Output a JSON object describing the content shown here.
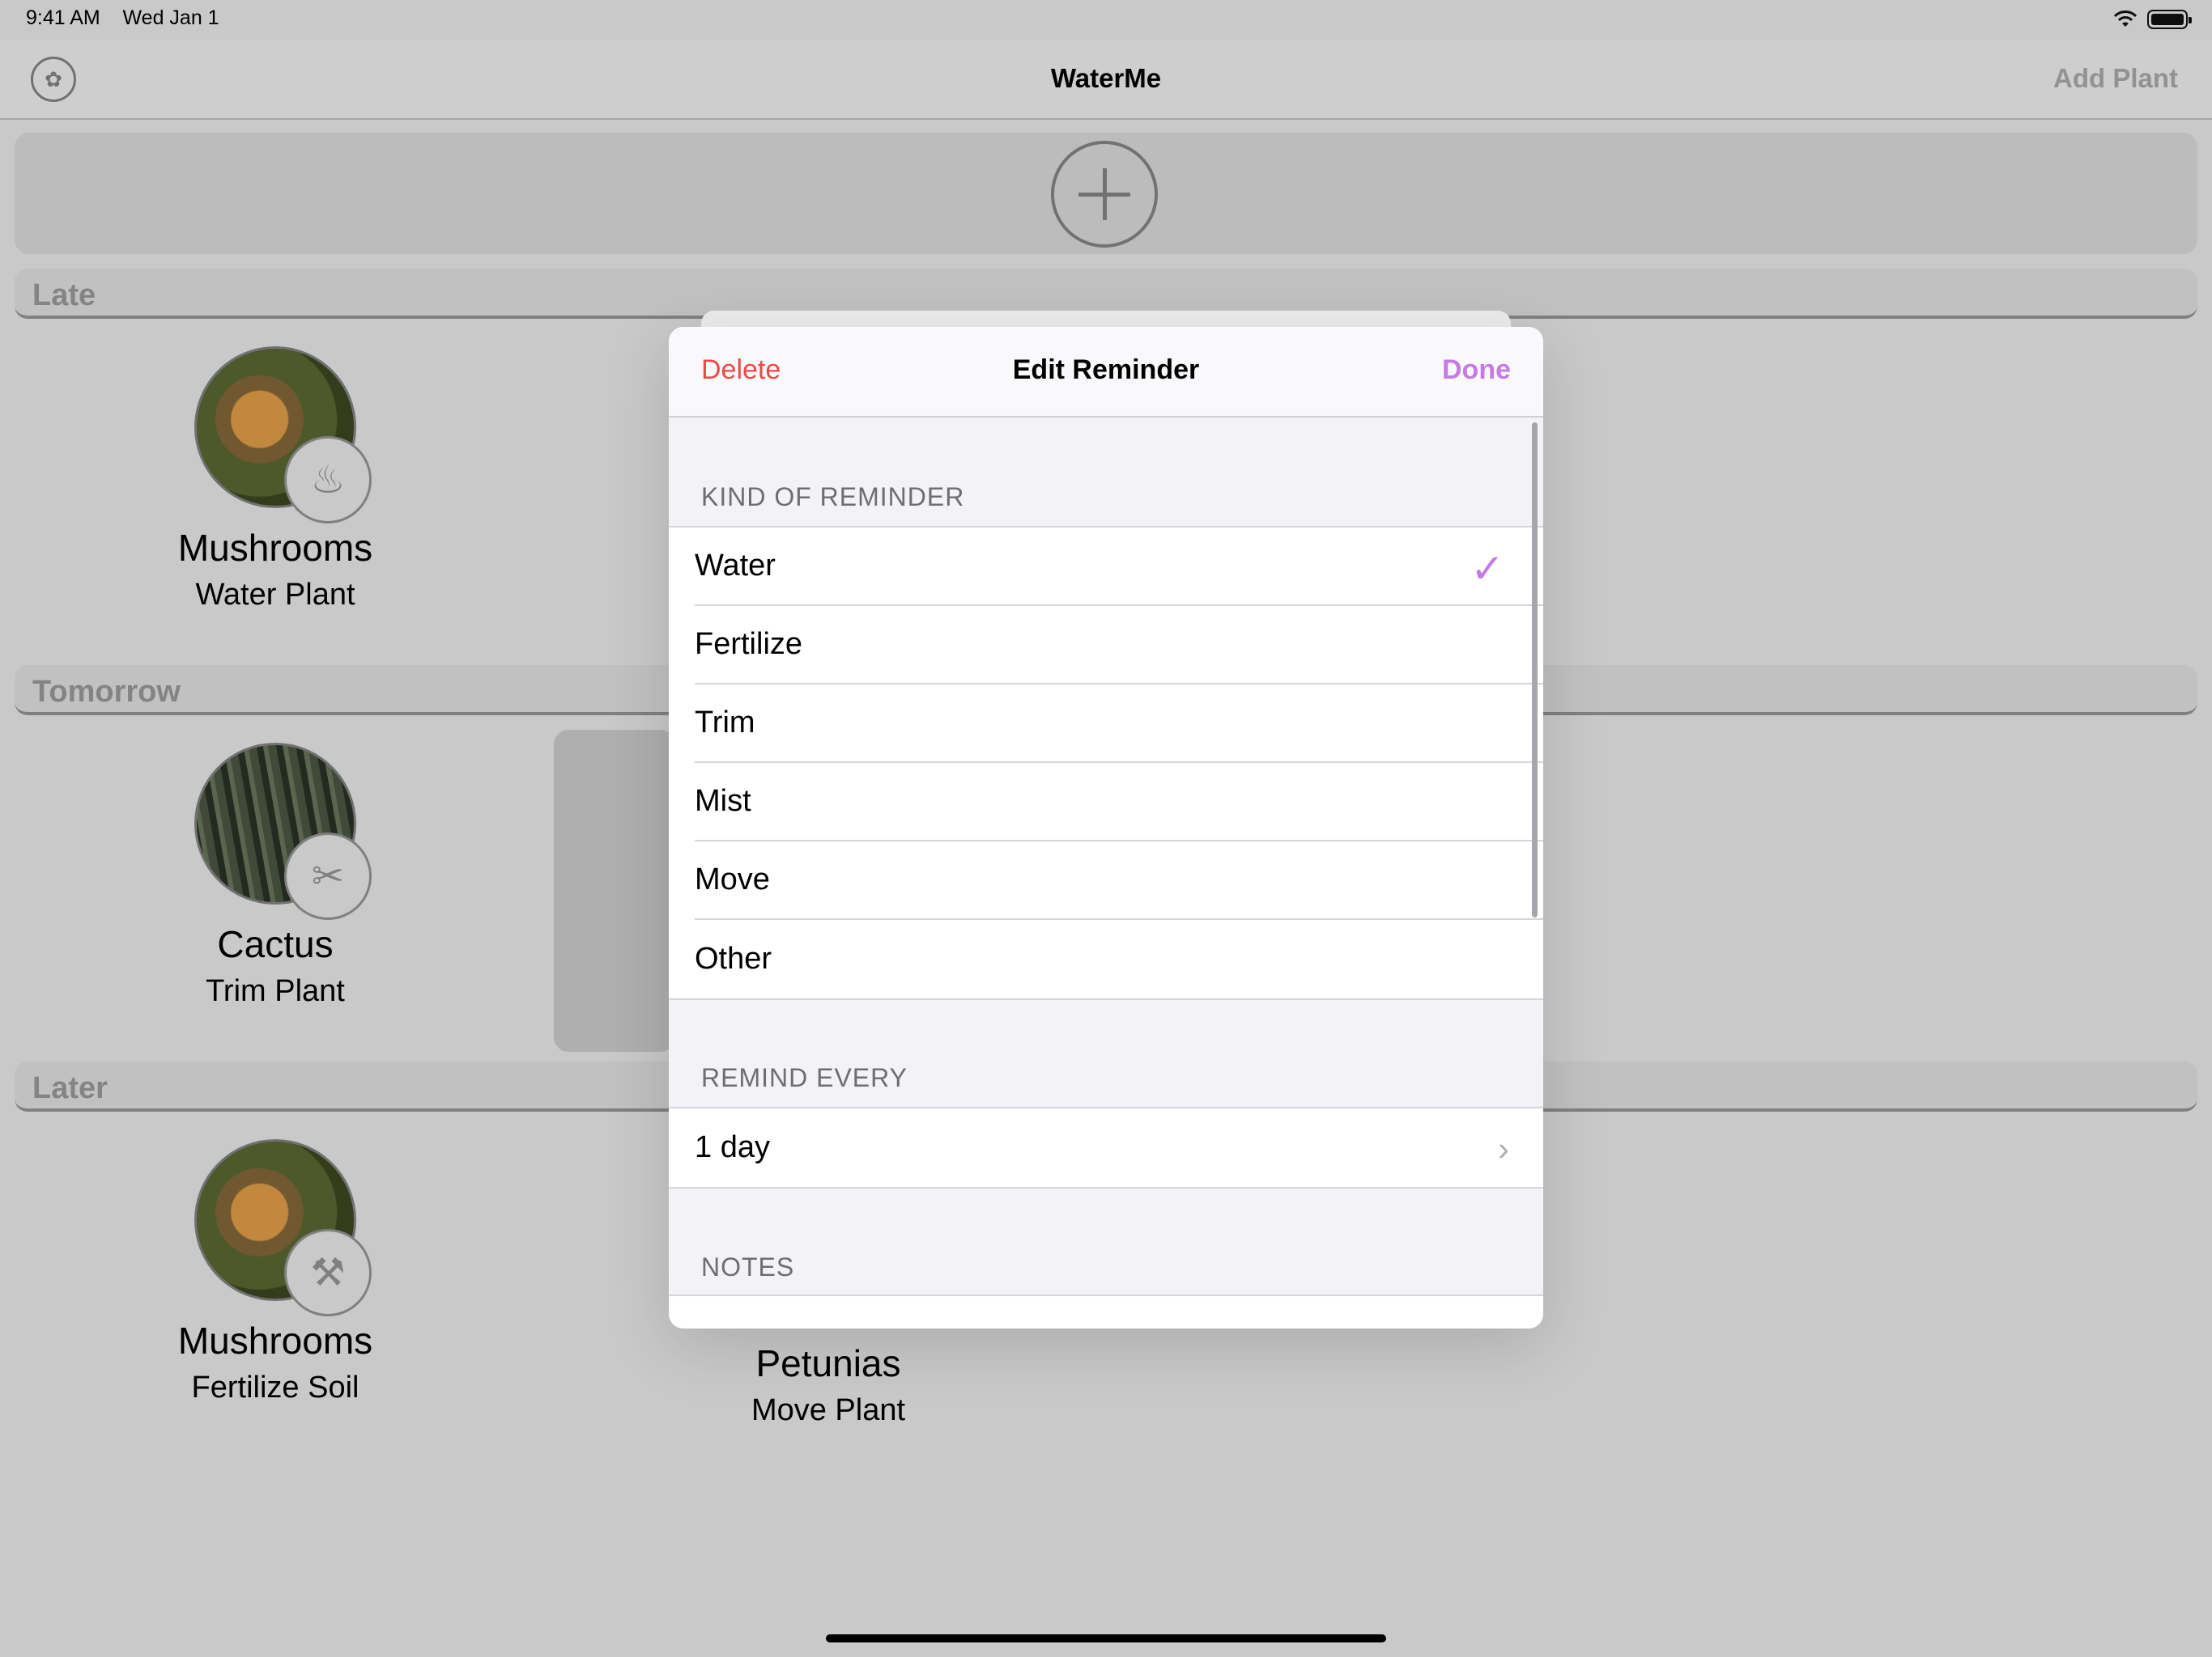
{
  "status": {
    "time": "9:41 AM",
    "date": "Wed Jan 1"
  },
  "nav": {
    "title": "WaterMe",
    "add_plant": "Add Plant"
  },
  "sections": [
    {
      "label": "Late"
    },
    {
      "label": "Tomorrow"
    },
    {
      "label": "Later"
    }
  ],
  "plants": [
    {
      "name": "Mushrooms",
      "task": "Water Plant"
    },
    {
      "name": "Cactus",
      "task": "Trim Plant"
    },
    {
      "name": "Mushrooms",
      "task": "Fertilize Soil"
    },
    {
      "name": "Petunias",
      "task": "Move Plant"
    }
  ],
  "modal": {
    "title": "Edit Reminder",
    "delete": "Delete",
    "done": "Done",
    "kind_header": "KIND OF REMINDER",
    "kinds": [
      "Water",
      "Fertilize",
      "Trim",
      "Mist",
      "Move",
      "Other"
    ],
    "selected_kind": "Water",
    "remind_header": "REMIND EVERY",
    "interval": "1 day",
    "notes_header": "NOTES"
  },
  "colors": {
    "accent": "#c67be4",
    "destructive": "#f04848"
  }
}
